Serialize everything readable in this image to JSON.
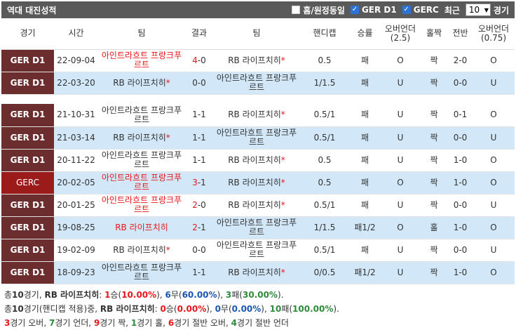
{
  "header": {
    "title": "역대 대진성적",
    "home_away_label": "홈/원정동일",
    "filter1": "GER D1",
    "filter2": "GERC",
    "recent_label": "최근",
    "count_value": "10",
    "games_label": "경기"
  },
  "columns": [
    "경기",
    "시간",
    "팀",
    "결과",
    "팀",
    "핸디캡",
    "승률",
    "오버언더(2.5)",
    "홀짝",
    "전반",
    "오버언더(0.75)"
  ],
  "rows": [
    {
      "league": "GER D1",
      "time": "22-09-04",
      "home": "아인트라흐트 프랑크푸르트",
      "home_red": true,
      "home_star": false,
      "score_a": "4",
      "score_b": "0",
      "away": "RB 라이프치히",
      "away_red": false,
      "away_star": true,
      "handicap": "0.5",
      "win": "패",
      "ou25": "O",
      "oddeven": "짝",
      "half": "2-0",
      "ou075": "O"
    },
    {
      "league": "GER D1",
      "time": "22-03-20",
      "home": "RB 라이프치히",
      "home_red": false,
      "home_star": true,
      "score_a": "0",
      "score_b": "0",
      "away": "아인트라흐트 프랑크푸르트",
      "away_red": false,
      "away_star": false,
      "handicap": "1/1.5",
      "win": "패",
      "ou25": "U",
      "oddeven": "짝",
      "half": "0-0",
      "ou075": "U"
    },
    {
      "league": "GER D1",
      "time": "21-10-31",
      "home": "아인트라흐트 프랑크푸르트",
      "home_red": false,
      "home_star": false,
      "score_a": "1",
      "score_b": "1",
      "away": "RB 라이프치히",
      "away_red": false,
      "away_star": true,
      "handicap": "0.5/1",
      "win": "패",
      "ou25": "U",
      "oddeven": "짝",
      "half": "0-1",
      "ou075": "O"
    },
    {
      "league": "GER D1",
      "time": "21-03-14",
      "home": "RB 라이프치히",
      "home_red": false,
      "home_star": true,
      "score_a": "1",
      "score_b": "1",
      "away": "아인트라흐트 프랑크푸르트",
      "away_red": false,
      "away_star": false,
      "handicap": "0.5/1",
      "win": "패",
      "ou25": "U",
      "oddeven": "짝",
      "half": "0-0",
      "ou075": "U"
    },
    {
      "league": "GER D1",
      "time": "20-11-22",
      "home": "아인트라흐트 프랑크푸르트",
      "home_red": false,
      "home_star": false,
      "score_a": "1",
      "score_b": "1",
      "away": "RB 라이프치히",
      "away_red": false,
      "away_star": true,
      "handicap": "0.5",
      "win": "패",
      "ou25": "U",
      "oddeven": "짝",
      "half": "1-0",
      "ou075": "O"
    },
    {
      "league": "GERC",
      "time": "20-02-05",
      "home": "아인트라흐트 프랑크푸르트",
      "home_red": true,
      "home_star": false,
      "score_a": "3",
      "score_b": "1",
      "away": "RB 라이프치히",
      "away_red": false,
      "away_star": true,
      "handicap": "0.5",
      "win": "패",
      "ou25": "O",
      "oddeven": "짝",
      "half": "1-0",
      "ou075": "O"
    },
    {
      "league": "GER D1",
      "time": "20-01-25",
      "home": "아인트라흐트 프랑크푸르트",
      "home_red": true,
      "home_star": false,
      "score_a": "2",
      "score_b": "0",
      "away": "RB 라이프치히",
      "away_red": false,
      "away_star": true,
      "handicap": "0.5/1",
      "win": "패",
      "ou25": "U",
      "oddeven": "짝",
      "half": "0-0",
      "ou075": "U"
    },
    {
      "league": "GER D1",
      "time": "19-08-25",
      "home": "RB 라이프치히",
      "home_red": true,
      "home_star": false,
      "score_a": "2",
      "score_b": "1",
      "away": "아인트라흐트 프랑크푸르트",
      "away_red": false,
      "away_star": false,
      "handicap": "1/1.5",
      "win": "패1/2",
      "ou25": "O",
      "oddeven": "홀",
      "half": "1-0",
      "ou075": "O"
    },
    {
      "league": "GER D1",
      "time": "19-02-09",
      "home": "RB 라이프치히",
      "home_red": false,
      "home_star": true,
      "score_a": "0",
      "score_b": "0",
      "away": "아인트라흐트 프랑크푸르트",
      "away_red": false,
      "away_star": false,
      "handicap": "0.5/1",
      "win": "패",
      "ou25": "U",
      "oddeven": "짝",
      "half": "0-0",
      "ou075": "U"
    },
    {
      "league": "GER D1",
      "time": "18-09-23",
      "home": "아인트라흐트 프랑크푸르트",
      "home_red": false,
      "home_star": false,
      "score_a": "1",
      "score_b": "1",
      "away": "RB 라이프치히",
      "away_red": false,
      "away_star": true,
      "handicap": "0/0.5",
      "win": "패1/2",
      "ou25": "U",
      "oddeven": "짝",
      "half": "1-0",
      "ou075": "O"
    }
  ],
  "summary": {
    "line1": {
      "prefix": "총",
      "games": "10",
      "games_unit": "경기, ",
      "team": "RB 라이프치히",
      "colon": ": ",
      "w": "1",
      "w_label": "승(",
      "w_pct": "10.00%",
      "w_close": "), ",
      "d": "6",
      "d_label": "무(",
      "d_pct": "60.00%",
      "d_close": "), ",
      "l": "3",
      "l_label": "패(",
      "l_pct": "30.00%",
      "l_close": ")."
    },
    "line2": {
      "prefix": "총",
      "games": "10",
      "games_unit": "경기(핸디캡 적용)중, ",
      "team": "RB 라이프치히",
      "colon": ": ",
      "w": "0",
      "w_label": "승(",
      "w_pct": "0.00%",
      "w_close": "), ",
      "d": "0",
      "d_label": "무(",
      "d_pct": "0.00%",
      "d_close": "), ",
      "l": "10",
      "l_label": "패(",
      "l_pct": "100.00%",
      "l_close": ")."
    },
    "line3": {
      "a": "3",
      "a_label": "경기 오버, ",
      "b": "7",
      "b_label": "경기 언더, ",
      "c": "9",
      "c_label": "경기 짝, ",
      "d": "1",
      "d_label": "경기 홀, ",
      "e": "6",
      "e_label": "경기 절반 오버, ",
      "f": "4",
      "f_label": "경기 절반 언더"
    }
  },
  "colors": {
    "win": "#e8171b",
    "draw": "#1a55b8",
    "loss": "#2e8b3a",
    "header": "#5a5a5a",
    "league": "#6b2d2d",
    "row_alt": "#d2e8f9"
  }
}
